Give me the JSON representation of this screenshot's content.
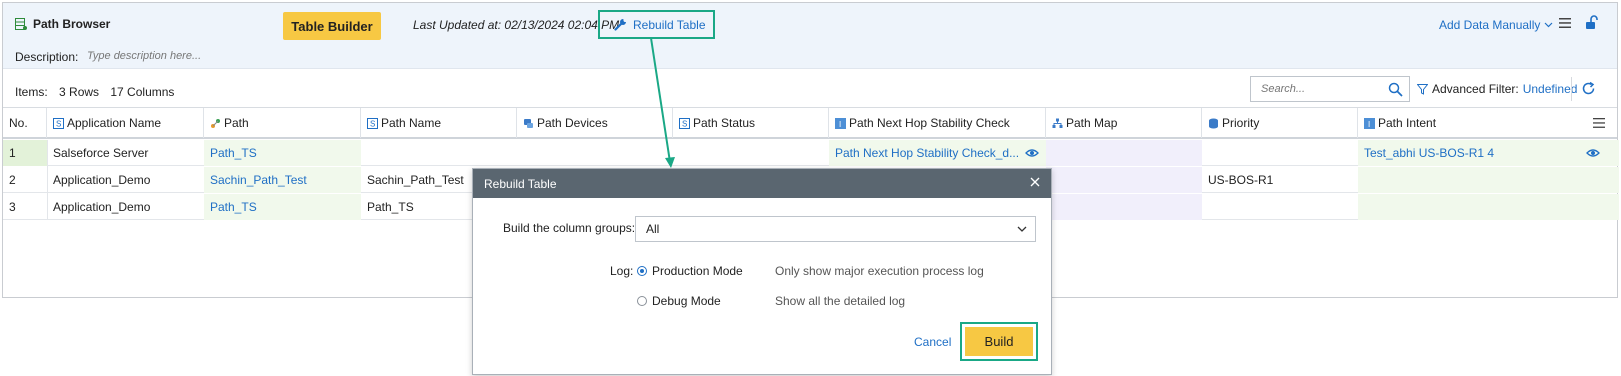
{
  "header": {
    "title": "Path Browser",
    "table_builder_label": "Table Builder",
    "last_updated": "Last Updated at: 02/13/2024 02:04 PM",
    "rebuild_label": "Rebuild Table",
    "add_data_label": "Add Data Manually",
    "description_label": "Description:",
    "description_placeholder": "Type description here..."
  },
  "toolbar": {
    "items_label": "Items:",
    "rows_text": "3 Rows",
    "columns_text": "17 Columns",
    "search_placeholder": "Search...",
    "advanced_filter_label": "Advanced Filter:",
    "advanced_filter_value": "Undefined"
  },
  "table": {
    "columns": [
      "No.",
      "Application Name",
      "Path",
      "Path Name",
      "Path Devices",
      "Path Status",
      "Path Next Hop Stability Check",
      "Path Map",
      "Priority",
      "Path Intent"
    ],
    "rows": [
      {
        "no": "1",
        "app": "Salseforce Server",
        "path": "Path_TS",
        "path_name": "",
        "stability": "Path Next Hop Stability Check_d...",
        "priority": "",
        "intent": "Test_abhi US-BOS-R1 4"
      },
      {
        "no": "2",
        "app": "Application_Demo",
        "path": "Sachin_Path_Test",
        "path_name": "Sachin_Path_Test",
        "stability": "",
        "priority": "US-BOS-R1",
        "intent": ""
      },
      {
        "no": "3",
        "app": "Application_Demo",
        "path": "Path_TS",
        "path_name": "Path_TS",
        "stability": "",
        "priority": "",
        "intent": ""
      }
    ]
  },
  "dialog": {
    "title": "Rebuild Table",
    "column_groups_label": "Build the column groups:",
    "column_groups_value": "All",
    "log_label": "Log:",
    "production_mode": "Production Mode",
    "production_desc": "Only show major execution process log",
    "debug_mode": "Debug Mode",
    "debug_desc": "Show all the detailed log",
    "cancel_label": "Cancel",
    "build_label": "Build"
  },
  "colors": {
    "accent_yellow": "#f7c843",
    "highlight_green": "#1aa886",
    "link_blue": "#1f6fc5",
    "dialog_header": "#5a6670"
  }
}
